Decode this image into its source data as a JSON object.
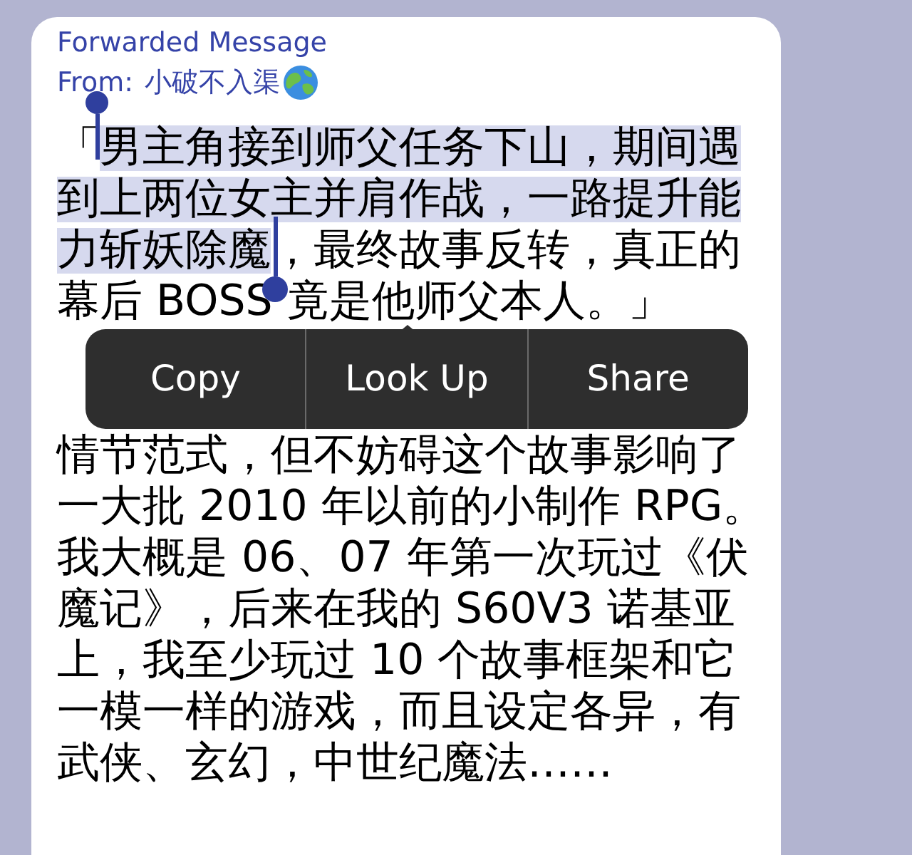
{
  "message": {
    "forwarded_label": "Forwarded Message",
    "from_label": "From:",
    "sender": "小破不入渠",
    "paragraphs": [
      {
        "lines": [
          [
            {
              "text": "「",
              "selected": false
            },
            {
              "text": "男主角接到师父任务下山，期间遇",
              "selected": true
            }
          ],
          [
            {
              "text": "到上两位女主并肩作战，一路提升能",
              "selected": true
            }
          ],
          [
            {
              "text": "力斩妖除魔",
              "selected": true
            },
            {
              "text": "，最终故事反转，真正的",
              "selected": false
            }
          ],
          [
            {
              "text": "幕后 BOSS 竟是他师父本人。」",
              "selected": false
            }
          ]
        ]
      },
      {
        "lines": [
          [
            {
              "text": "情节范式，但不妨碍这个故事影响了",
              "selected": false
            }
          ],
          [
            {
              "text": "一大批 2010 年以前的小制作 RPG。",
              "selected": false
            }
          ],
          [
            {
              "text": "我大概是 06、07 年第一次玩过《伏",
              "selected": false
            }
          ],
          [
            {
              "text": "魔记》，后来在我的 S60V3 诺基亚",
              "selected": false
            }
          ],
          [
            {
              "text": "上，我至少玩过 10 个故事框架和它",
              "selected": false
            }
          ],
          [
            {
              "text": "一模一样的游戏，而且设定各异，有",
              "selected": false
            }
          ],
          [
            {
              "text": "武侠、玄幻，中世纪魔法……",
              "selected": false
            }
          ]
        ]
      }
    ]
  },
  "edit_menu": {
    "items": [
      "Copy",
      "Look Up",
      "Share"
    ]
  }
}
